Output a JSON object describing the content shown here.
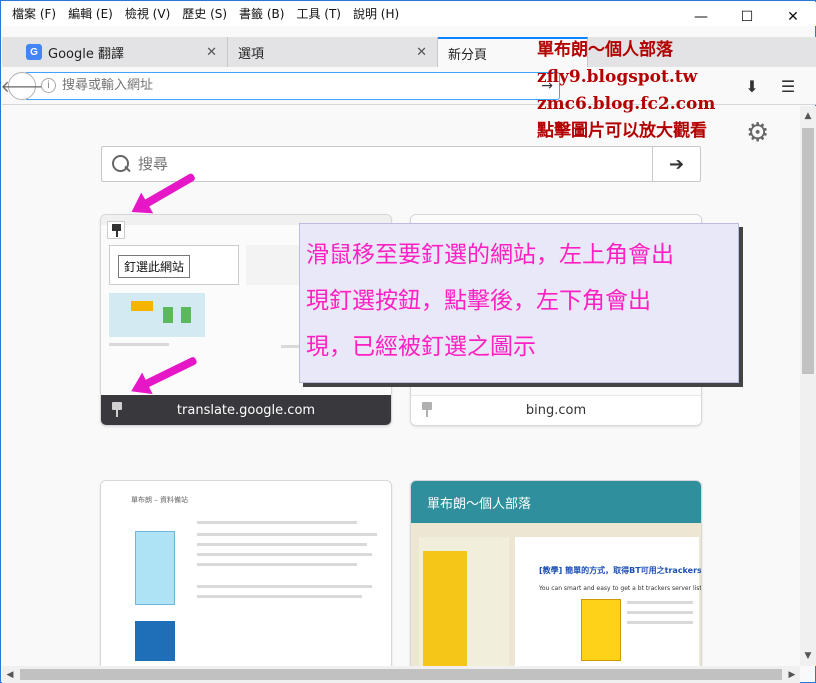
{
  "menubar": {
    "items": [
      "檔案 (F)",
      "編輯 (E)",
      "檢視 (V)",
      "歷史 (S)",
      "書籤 (B)",
      "工具 (T)",
      "說明 (H)"
    ],
    "minimize": "—",
    "maximize": "☐",
    "close": "✕"
  },
  "tabs": [
    {
      "label": "Google 翻譯",
      "favicon": "G"
    },
    {
      "label": "選項"
    },
    {
      "label": "新分頁",
      "active": true
    }
  ],
  "navbar": {
    "url_placeholder": "搜尋或輸入網址"
  },
  "search": {
    "placeholder": "搜尋"
  },
  "tiles": [
    {
      "label": "translate.google.com",
      "pinned": true,
      "tooltip": "釘選此網站"
    },
    {
      "label": "bing.com",
      "pinned": true
    }
  ],
  "annotation": {
    "lines": [
      "滑鼠移至要釘選的網站，左上角會出",
      "現釘選按鈕，點擊後，左下角會出",
      "現，已經被釘選之圖示"
    ]
  },
  "blog": {
    "lines": [
      "單布朗～個人部落",
      "zfly9.blogspot.tw",
      "zmc6.blog.fc2.com",
      "點擊圖片可以放大觀看"
    ]
  },
  "thumbs": {
    "blog_title_small": "單布朗 – 資料備站",
    "blog_title_big": "單布朗～個人部落",
    "post_title": "[教學] 簡單的方式，取得BT可用之trackers",
    "post_sub": "You can smart and easy to get a bt trackers server list"
  },
  "colors": {
    "accent": "#0a84ff",
    "annotation_text": "#ff1fc2",
    "blog_text": "#b30000",
    "arrow": "#e617c7"
  }
}
